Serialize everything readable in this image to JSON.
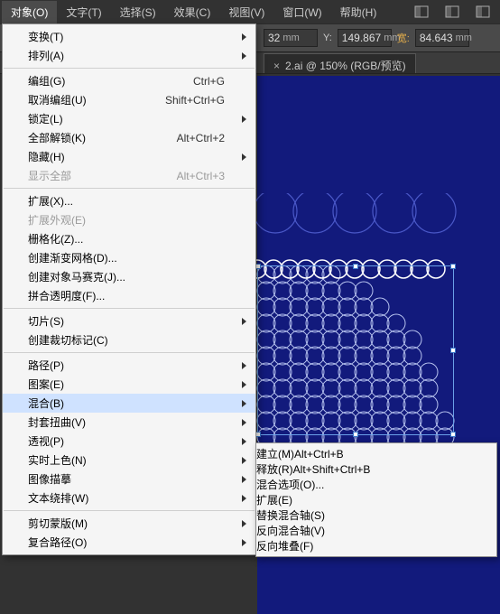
{
  "menubar": {
    "items": [
      "对象(O)",
      "文字(T)",
      "选择(S)",
      "效果(C)",
      "视图(V)",
      "窗口(W)",
      "帮助(H)"
    ],
    "selected": 0
  },
  "options": {
    "ylabel": "Y:",
    "yval": "149.867",
    "wlabel": "宽:",
    "wval": "84.643",
    "unit": "mm",
    "prefix": "32"
  },
  "tab": {
    "label": "2.ai @ 150% (RGB/预览)",
    "close": "×"
  },
  "menu": {
    "groups": [
      [
        {
          "l": "变换(T)",
          "sub": 1
        },
        {
          "l": "排列(A)",
          "sub": 1
        }
      ],
      [
        {
          "l": "编组(G)",
          "sc": "Ctrl+G"
        },
        {
          "l": "取消编组(U)",
          "sc": "Shift+Ctrl+G"
        },
        {
          "l": "锁定(L)",
          "sub": 1
        },
        {
          "l": "全部解锁(K)",
          "sc": "Alt+Ctrl+2"
        },
        {
          "l": "隐藏(H)",
          "sub": 1
        },
        {
          "l": "显示全部",
          "sc": "Alt+Ctrl+3",
          "dis": 1
        }
      ],
      [
        {
          "l": "扩展(X)..."
        },
        {
          "l": "扩展外观(E)",
          "dis": 1
        },
        {
          "l": "栅格化(Z)..."
        },
        {
          "l": "创建渐变网格(D)..."
        },
        {
          "l": "创建对象马赛克(J)..."
        },
        {
          "l": "拼合透明度(F)..."
        }
      ],
      [
        {
          "l": "切片(S)",
          "sub": 1
        },
        {
          "l": "创建裁切标记(C)"
        }
      ],
      [
        {
          "l": "路径(P)",
          "sub": 1
        },
        {
          "l": "图案(E)",
          "sub": 1
        },
        {
          "l": "混合(B)",
          "sub": 1,
          "hov": 1
        },
        {
          "l": "封套扭曲(V)",
          "sub": 1
        },
        {
          "l": "透视(P)",
          "sub": 1
        },
        {
          "l": "实时上色(N)",
          "sub": 1
        },
        {
          "l": "图像描摹",
          "sub": 1
        },
        {
          "l": "文本绕排(W)",
          "sub": 1
        }
      ],
      [
        {
          "l": "剪切蒙版(M)",
          "sub": 1
        },
        {
          "l": "复合路径(O)",
          "sub": 1
        }
      ]
    ]
  },
  "submenu": {
    "groups": [
      [
        {
          "l": "建立(M)",
          "sc": "Alt+Ctrl+B"
        },
        {
          "l": "释放(R)",
          "sc": "Alt+Shift+Ctrl+B"
        }
      ],
      [
        {
          "l": "混合选项(O)..."
        }
      ],
      [
        {
          "l": "扩展(E)",
          "hov": 1
        }
      ],
      [
        {
          "l": "替换混合轴(S)",
          "dis": 1
        },
        {
          "l": "反向混合轴(V)"
        },
        {
          "l": "反向堆叠(F)"
        }
      ]
    ]
  }
}
